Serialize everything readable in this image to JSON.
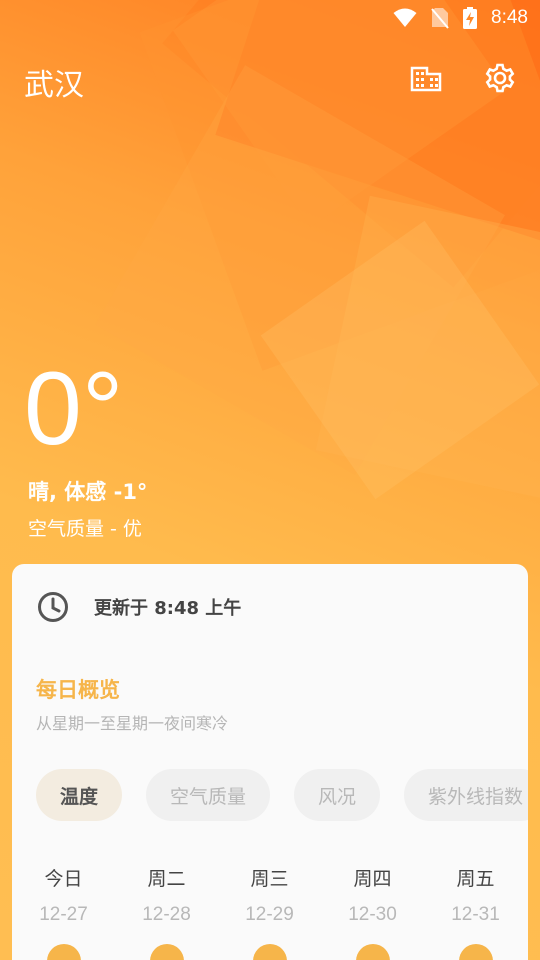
{
  "status_bar": {
    "time": "8:48",
    "wifi_icon": "wifi-icon",
    "signal_icon": "no-sim-icon",
    "battery_icon": "battery-charging-icon"
  },
  "header": {
    "city": "武汉",
    "buildings_icon": "buildings-icon",
    "settings_icon": "gear-icon"
  },
  "current": {
    "temperature": "0°",
    "condition": "晴, 体感 -1°",
    "air_quality": "空气质量 - 优"
  },
  "card": {
    "update_text": "更新于 8:48 上午",
    "clock_icon": "clock-icon",
    "overview_title": "每日概览",
    "overview_subtitle": "从星期一至星期一夜间寒冷",
    "chips": [
      "温度",
      "空气质量",
      "风况",
      "紫外线指数"
    ],
    "active_chip": "温度",
    "days": [
      {
        "name": "今日",
        "date": "12-27"
      },
      {
        "name": "周二",
        "date": "12-28"
      },
      {
        "name": "周三",
        "date": "12-29"
      },
      {
        "name": "周四",
        "date": "12-30"
      },
      {
        "name": "周五",
        "date": "12-31"
      }
    ],
    "day_icon": "sun-icon"
  },
  "colors": {
    "accent": "#f6b54a",
    "bg_top": "#ff7a1f",
    "bg_bottom": "#ffbe52"
  }
}
